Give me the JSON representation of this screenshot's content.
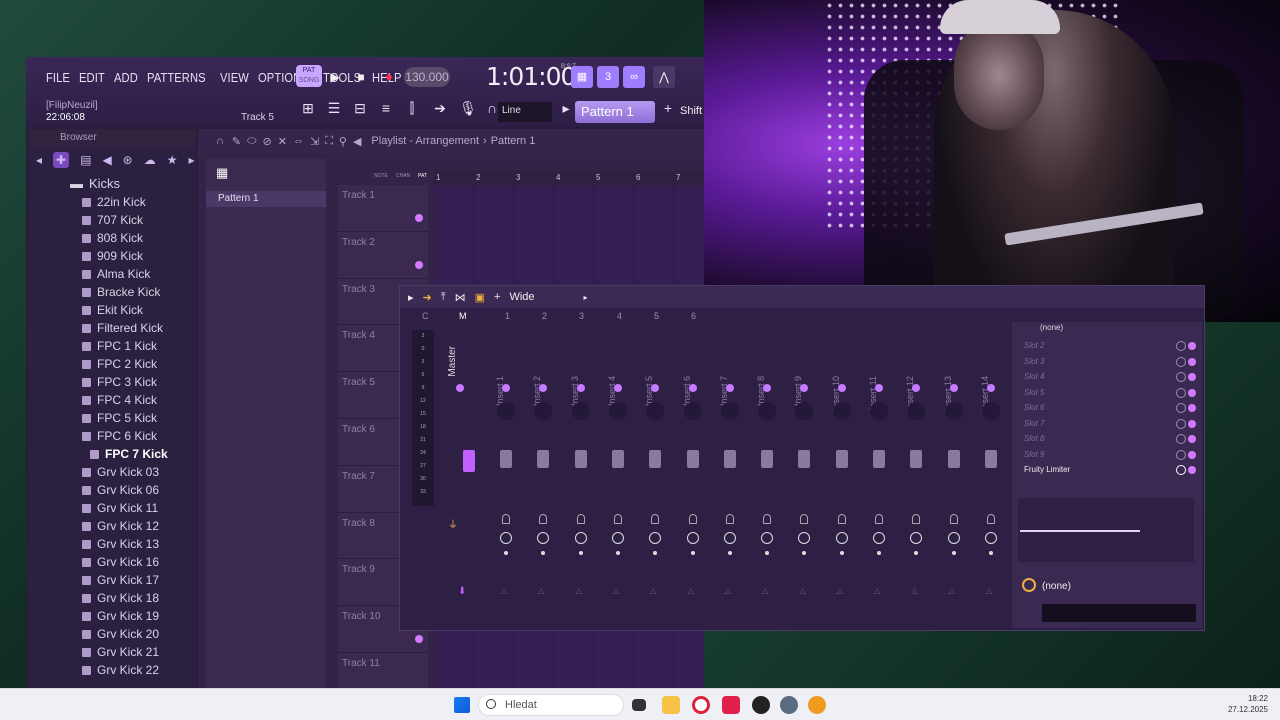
{
  "menu": [
    "FILE",
    "EDIT",
    "ADD",
    "PATTERNS",
    "VIEW",
    "OPTIONS",
    "TOOLS",
    "HELP"
  ],
  "transport": {
    "pat_label": "PAT",
    "song_label": "SONG",
    "tempo": "130.000",
    "time": "1:01:00",
    "bst": "B:S:T"
  },
  "hint": {
    "user": "[FilipNeuzil]",
    "clock": "22:06:08",
    "track": "Track 5"
  },
  "snap": "Line",
  "pattern_name": "Pattern 1",
  "shift": "Shift",
  "browser": {
    "title": "Browser",
    "folder": "Kicks",
    "items": [
      "22in Kick",
      "707 Kick",
      "808 Kick",
      "909 Kick",
      "Alma Kick",
      "Bracke Kick",
      "Ekit Kick",
      "Filtered Kick",
      "FPC 1 Kick",
      "FPC 2 Kick",
      "FPC 3 Kick",
      "FPC 4 Kick",
      "FPC 5 Kick",
      "FPC 6 Kick",
      "FPC 7 Kick",
      "Grv Kick 03",
      "Grv Kick 06",
      "Grv Kick 11",
      "Grv Kick 12",
      "Grv Kick 13",
      "Grv Kick 16",
      "Grv Kick 17",
      "Grv Kick 18",
      "Grv Kick 19",
      "Grv Kick 20",
      "Grv Kick 21",
      "Grv Kick 22"
    ],
    "selected": "FPC 7 Kick"
  },
  "playlist": {
    "title": "Playlist - Arrangement",
    "pattern": "Pattern 1",
    "picker_item": "Pattern 1",
    "tracks": [
      "Track 1",
      "Track 2",
      "Track 3",
      "Track 4",
      "Track 5",
      "Track 6",
      "Track 7",
      "Track 8",
      "Track 9",
      "Track 10",
      "Track 11"
    ],
    "ruler": [
      "1",
      "2",
      "3",
      "4",
      "5",
      "6",
      "7"
    ],
    "ruler_labels": [
      "NOTE",
      "CHAN",
      "PAT"
    ]
  },
  "mixer": {
    "preset": "Wide",
    "master": "Master",
    "col_letters": [
      "C",
      "M"
    ],
    "col_nums": [
      "1",
      "2",
      "3",
      "4",
      "5",
      "6"
    ],
    "inserts": [
      "Insert 1",
      "Insert 2",
      "Insert 3",
      "Insert 4",
      "Insert 5",
      "Insert 6",
      "Insert 7",
      "Insert 8",
      "Insert 9",
      "Insert 10",
      "Insert 11",
      "Insert 12",
      "Insert 13",
      "Insert 14"
    ],
    "meter": [
      "3",
      "0",
      "3",
      "6",
      "9",
      "12",
      "15",
      "18",
      "21",
      "24",
      "27",
      "30",
      "33"
    ]
  },
  "fx_slots": {
    "top": "(none)",
    "slots": [
      "Slot 2",
      "Slot 3",
      "Slot 4",
      "Slot 5",
      "Slot 6",
      "Slot 7",
      "Slot 8",
      "Slot 9"
    ],
    "active": "Fruity Limiter",
    "bottom": "(none)"
  },
  "taskbar": {
    "search": "Hledat",
    "time": "18:22",
    "date": "27.12.2025"
  }
}
